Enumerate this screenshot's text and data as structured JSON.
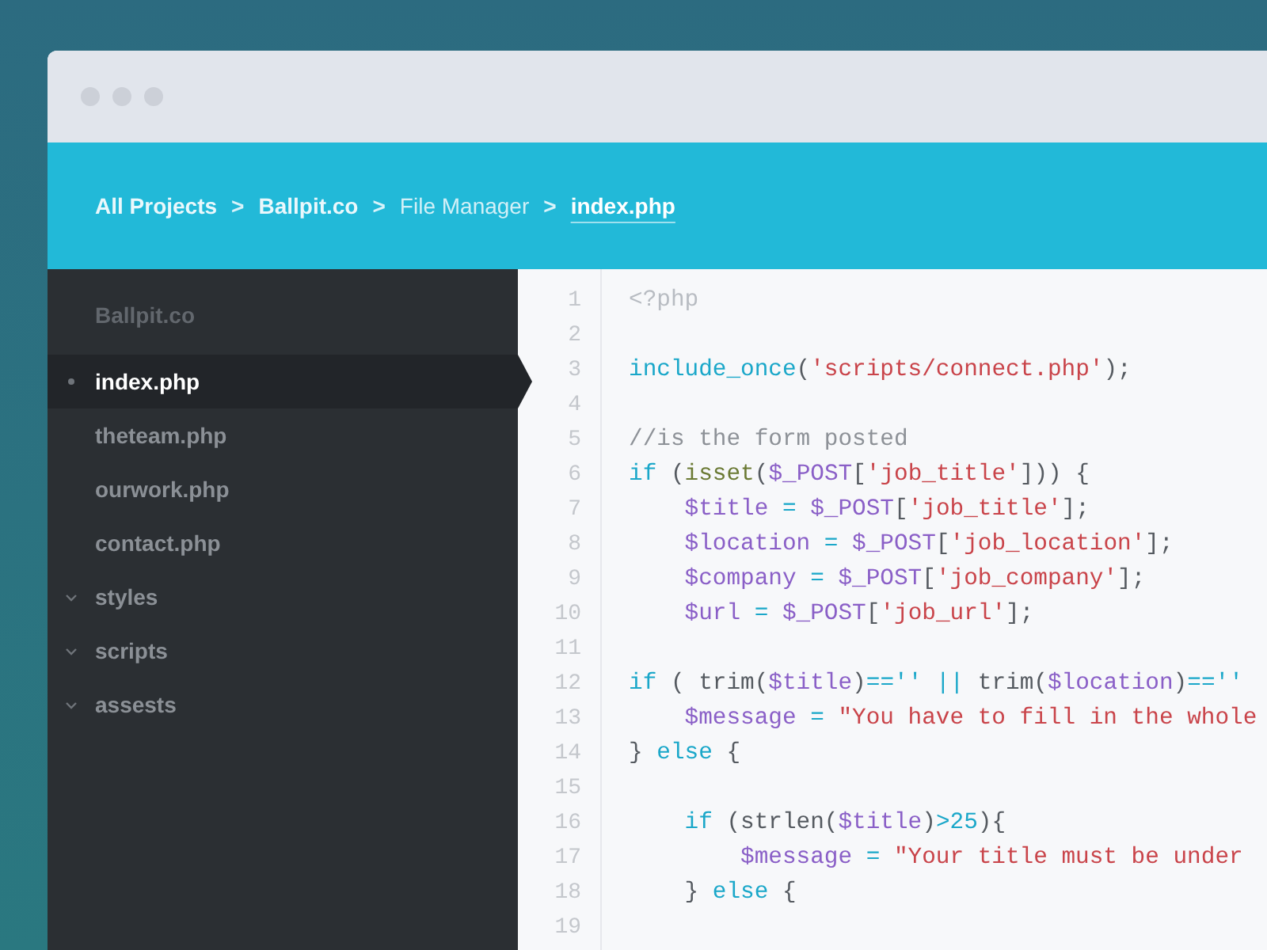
{
  "breadcrumb": {
    "separator": ">",
    "items": [
      {
        "label": "All Projects",
        "kind": "link",
        "selected": false
      },
      {
        "label": "Ballpit.co",
        "kind": "link",
        "selected": false
      },
      {
        "label": "File Manager",
        "kind": "plain",
        "selected": false
      },
      {
        "label": "index.php",
        "kind": "link",
        "selected": true
      }
    ]
  },
  "sidebar": {
    "title": "Ballpit.co",
    "items": [
      {
        "label": "index.php",
        "kind": "file",
        "selected": true
      },
      {
        "label": "theteam.php",
        "kind": "file",
        "selected": false
      },
      {
        "label": "ourwork.php",
        "kind": "file",
        "selected": false
      },
      {
        "label": "contact.php",
        "kind": "file",
        "selected": false
      },
      {
        "label": "styles",
        "kind": "folder",
        "selected": false
      },
      {
        "label": "scripts",
        "kind": "folder",
        "selected": false
      },
      {
        "label": "assests",
        "kind": "folder",
        "selected": false
      }
    ]
  },
  "editor": {
    "lines": [
      {
        "number": "1",
        "kind": "top",
        "tokens": [
          {
            "text": "<?php",
            "kind": "tag"
          }
        ]
      },
      {
        "number": "2",
        "kind": "blank"
      },
      {
        "number": "3",
        "kind": "top",
        "tokens": [
          {
            "text": "include_once",
            "kind": "keyword"
          },
          {
            "text": "(",
            "kind": "plain"
          },
          {
            "text": "'scripts/connect.php'",
            "kind": "string"
          },
          {
            "text": ");",
            "kind": "plain"
          }
        ]
      },
      {
        "number": "4",
        "kind": "blank"
      },
      {
        "number": "5",
        "kind": "top",
        "tokens": [
          {
            "text": "//is the form posted",
            "kind": "comment"
          }
        ]
      },
      {
        "number": "6",
        "kind": "top",
        "tokens": [
          {
            "text": "if",
            "kind": "keyword"
          },
          {
            "text": " (",
            "kind": "plain"
          },
          {
            "text": "isset",
            "kind": "function"
          },
          {
            "text": "(",
            "kind": "plain"
          },
          {
            "text": "$_POST",
            "kind": "variable"
          },
          {
            "text": "[",
            "kind": "plain"
          },
          {
            "text": "'job_title'",
            "kind": "string"
          },
          {
            "text": "])) {",
            "kind": "plain"
          }
        ]
      },
      {
        "number": "7",
        "kind": "indented",
        "tokens": [
          {
            "text": "$title",
            "kind": "variable"
          },
          {
            "text": " = ",
            "kind": "operator"
          },
          {
            "text": "$_POST",
            "kind": "variable"
          },
          {
            "text": "[",
            "kind": "plain"
          },
          {
            "text": "'job_title'",
            "kind": "string"
          },
          {
            "text": "];",
            "kind": "plain"
          }
        ]
      },
      {
        "number": "8",
        "kind": "indented",
        "tokens": [
          {
            "text": "$location",
            "kind": "variable"
          },
          {
            "text": " = ",
            "kind": "operator"
          },
          {
            "text": "$_POST",
            "kind": "variable"
          },
          {
            "text": "[",
            "kind": "plain"
          },
          {
            "text": "'job_location'",
            "kind": "string"
          },
          {
            "text": "];",
            "kind": "plain"
          }
        ]
      },
      {
        "number": "9",
        "kind": "indented",
        "tokens": [
          {
            "text": "$company",
            "kind": "variable"
          },
          {
            "text": " = ",
            "kind": "operator"
          },
          {
            "text": "$_POST",
            "kind": "variable"
          },
          {
            "text": "[",
            "kind": "plain"
          },
          {
            "text": "'job_company'",
            "kind": "string"
          },
          {
            "text": "];",
            "kind": "plain"
          }
        ]
      },
      {
        "number": "10",
        "kind": "indented",
        "tokens": [
          {
            "text": "$url",
            "kind": "variable"
          },
          {
            "text": " = ",
            "kind": "operator"
          },
          {
            "text": "$_POST",
            "kind": "variable"
          },
          {
            "text": "[",
            "kind": "plain"
          },
          {
            "text": "'job_url'",
            "kind": "string"
          },
          {
            "text": "];",
            "kind": "plain"
          }
        ]
      },
      {
        "number": "11",
        "kind": "blank"
      },
      {
        "number": "12",
        "kind": "top",
        "tokens": [
          {
            "text": "if",
            "kind": "keyword"
          },
          {
            "text": " ( trim(",
            "kind": "plain"
          },
          {
            "text": "$title",
            "kind": "variable"
          },
          {
            "text": ")",
            "kind": "plain"
          },
          {
            "text": "=='' || ",
            "kind": "operator"
          },
          {
            "text": "trim(",
            "kind": "plain"
          },
          {
            "text": "$location",
            "kind": "variable"
          },
          {
            "text": ")",
            "kind": "plain"
          },
          {
            "text": "==''",
            "kind": "operator"
          }
        ]
      },
      {
        "number": "13",
        "kind": "indented",
        "tokens": [
          {
            "text": "$message",
            "kind": "variable"
          },
          {
            "text": " = ",
            "kind": "operator"
          },
          {
            "text": "\"You have to fill in the whole",
            "kind": "string"
          }
        ]
      },
      {
        "number": "14",
        "kind": "top",
        "tokens": [
          {
            "text": "} ",
            "kind": "plain"
          },
          {
            "text": "else",
            "kind": "keyword"
          },
          {
            "text": " {",
            "kind": "plain"
          }
        ]
      },
      {
        "number": "15",
        "kind": "blank"
      },
      {
        "number": "16",
        "kind": "indented",
        "tokens": [
          {
            "text": "if",
            "kind": "keyword"
          },
          {
            "text": " (strlen(",
            "kind": "plain"
          },
          {
            "text": "$title",
            "kind": "variable"
          },
          {
            "text": ")",
            "kind": "plain"
          },
          {
            "text": ">25",
            "kind": "operator"
          },
          {
            "text": "){",
            "kind": "plain"
          }
        ]
      },
      {
        "number": "17",
        "kind": "double-indented",
        "tokens": [
          {
            "text": "$message",
            "kind": "variable"
          },
          {
            "text": " = ",
            "kind": "operator"
          },
          {
            "text": "\"Your title must be under",
            "kind": "string"
          }
        ]
      },
      {
        "number": "18",
        "kind": "indented",
        "tokens": [
          {
            "text": "} ",
            "kind": "plain"
          },
          {
            "text": "else",
            "kind": "keyword"
          },
          {
            "text": " {",
            "kind": "plain"
          }
        ]
      },
      {
        "number": "19",
        "kind": "blank"
      }
    ]
  }
}
